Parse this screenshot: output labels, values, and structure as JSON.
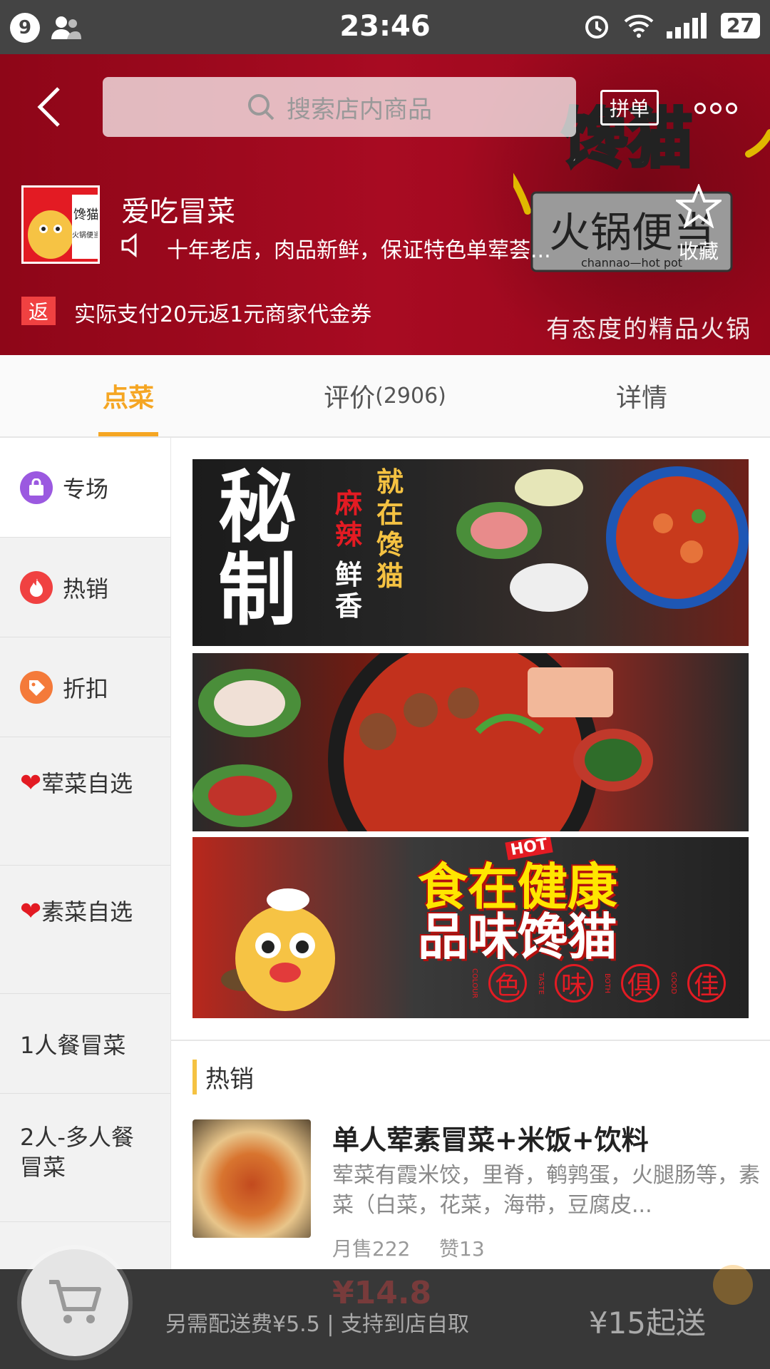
{
  "status_bar": {
    "notif_count": "9",
    "time": "23:46",
    "battery": "27"
  },
  "header": {
    "search_placeholder": "搜索店内商品",
    "pindan_label": "拼单",
    "shop_name": "爱吃冒菜",
    "notice": "十年老店，肉品新鲜，保证特色单荤荟...",
    "favorite_label": "收藏",
    "promo_badge": "返",
    "promo_text": "实际支付20元返1元商家代金券",
    "slogan": "有态度的精品火锅",
    "brand_title": "馋猫",
    "brand_subtitle": "火锅便当",
    "brand_en": "channao—hot pot",
    "logo_text": "馋猫",
    "logo_sub": "火锅便当"
  },
  "tabs": [
    {
      "label": "点菜",
      "active": true
    },
    {
      "label": "评价",
      "count": "(2906)"
    },
    {
      "label": "详情"
    }
  ],
  "sidebar": [
    {
      "label": "专场",
      "icon": "bag-icon"
    },
    {
      "label": "热销",
      "icon": "flame-icon"
    },
    {
      "label": "折扣",
      "icon": "discount-tag-icon"
    },
    {
      "label": "荤菜自选",
      "icon": "heart-icon"
    },
    {
      "label": "素菜自选",
      "icon": "heart-icon"
    },
    {
      "label": "1人餐冒菜"
    },
    {
      "label": "2人-多人餐冒菜"
    }
  ],
  "banners": {
    "b1": {
      "big": "秘制",
      "line1": "麻辣",
      "line2": "鲜香",
      "line3": "就在馋猫"
    },
    "b3": {
      "line1": "食在健康",
      "line2": "品味馋猫",
      "hot": "HOT",
      "c1": "色",
      "c2": "味",
      "c3": "俱",
      "c4": "佳",
      "en1": "COLOUR",
      "en2": "TASTE",
      "en3": "BOTH",
      "en4": "GOOD"
    }
  },
  "section": {
    "title": "热销"
  },
  "dish": {
    "name": "单人荤素冒菜+米饭+饮料",
    "description": "荤菜有霞米饺，里脊，鹌鹑蛋，火腿肠等，素菜（白菜，花菜，海带，豆腐皮...",
    "sales": "月售222",
    "likes": "赞13",
    "price": "¥14.8"
  },
  "cart_bar": {
    "delivery": "另需配送费¥5.5 | 支持到店自取",
    "min_order": "¥15起送"
  },
  "colors": {
    "accent": "#f5a623",
    "header_red": "#a80b22",
    "promo_red": "#f04141"
  }
}
